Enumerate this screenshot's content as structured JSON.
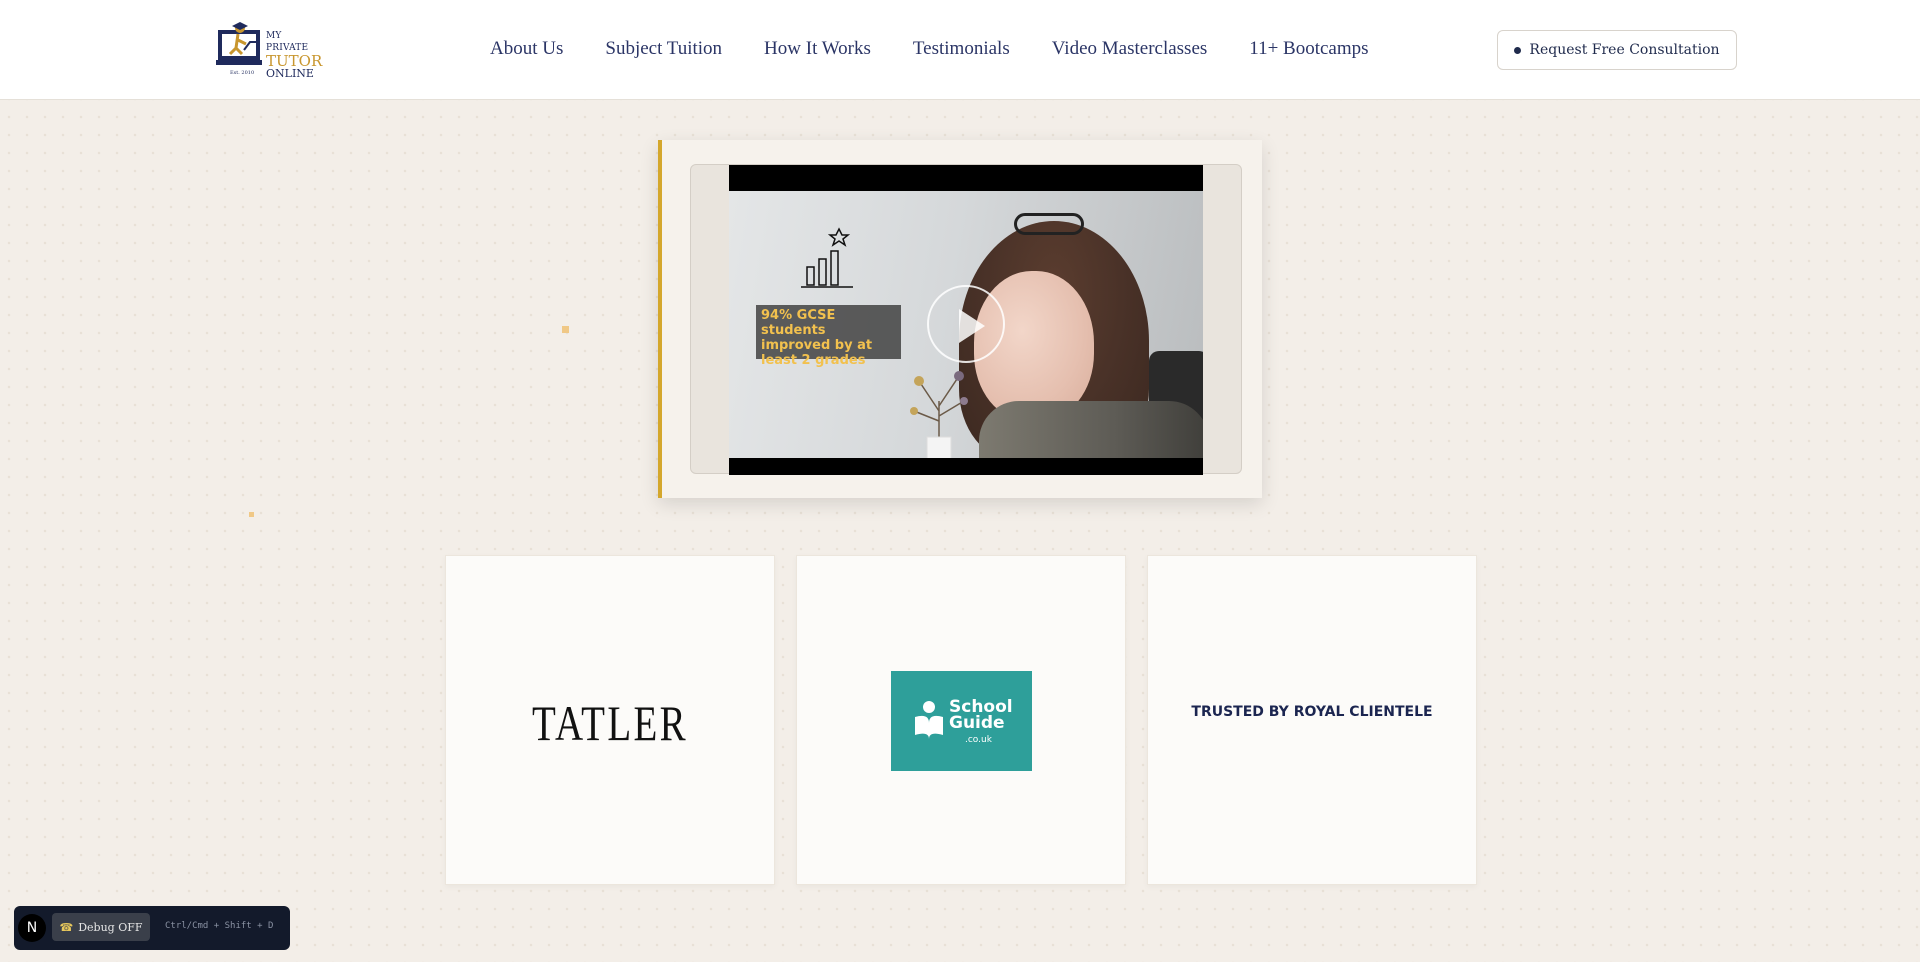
{
  "brand": {
    "logo_line1": "MY PRIVATE",
    "logo_line2": "TUTOR",
    "logo_line3": "ONLINE",
    "logo_est": "Est. 2010"
  },
  "nav": {
    "items": [
      {
        "label": "About Us"
      },
      {
        "label": "Subject Tuition"
      },
      {
        "label": "How It Works"
      },
      {
        "label": "Testimonials"
      },
      {
        "label": "Video Masterclasses"
      },
      {
        "label": "11+ Bootcamps"
      }
    ]
  },
  "cta": {
    "label": "Request Free Consultation"
  },
  "video": {
    "overlay_stat": "94% GCSE students improved by at least 2 grades",
    "play_icon": "play-icon"
  },
  "press": {
    "tatler": "TATLER",
    "school_guide_line1": "School",
    "school_guide_line2": "Guide",
    "school_guide_sub": ".co.uk",
    "royal": "TRUSTED BY ROYAL CLIENTELE"
  },
  "debug": {
    "logo_letter": "N",
    "toggle_label": "Debug OFF",
    "shortcut": "Ctrl/Cmd + Shift + D"
  },
  "colors": {
    "accent_gold": "#d4a72c",
    "navy": "#1f2a5c",
    "teal": "#2e9f9a",
    "background": "#f3eee8"
  }
}
